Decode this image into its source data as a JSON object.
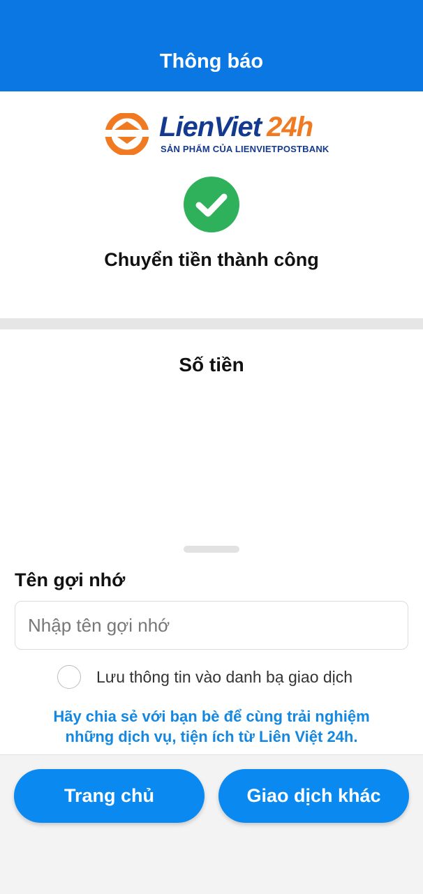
{
  "header": {
    "title": "Thông báo"
  },
  "logo": {
    "name": "LienViet",
    "number": "24h",
    "subtitle": "SẢN PHẨM CỦA LIENVIETPOSTBANK"
  },
  "status": {
    "icon": "check-circle-icon",
    "text": "Chuyển tiền thành công"
  },
  "amount": {
    "label": "Số tiền"
  },
  "nickname": {
    "label": "Tên gợi nhớ",
    "placeholder": "Nhập tên gợi nhớ",
    "value": ""
  },
  "save_contact": {
    "label": "Lưu thông tin vào danh bạ giao dịch",
    "checked": false
  },
  "share_message": "Hãy chia sẻ với bạn bè để cùng trải nghiệm những dịch vụ, tiện ích từ Liên Việt 24h.",
  "buttons": {
    "home": "Trang chủ",
    "other_transaction": "Giao dịch khác"
  },
  "colors": {
    "header": "#0b77e3",
    "success": "#2fb05a",
    "button": "#0a8af0",
    "link_text": "#1487e0",
    "brand_orange": "#f07a22",
    "brand_navy": "#143a8f"
  }
}
